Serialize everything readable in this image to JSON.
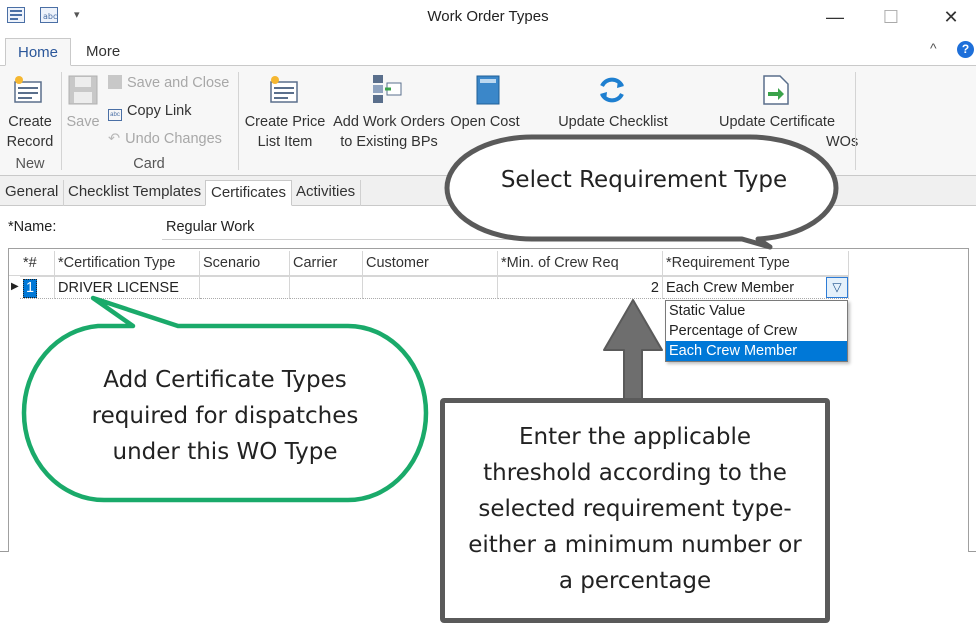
{
  "window": {
    "title": "Work Order Types",
    "minimize": "—",
    "maximize": "☐",
    "close": "✕",
    "collapse_ribbon": "^",
    "help": "?"
  },
  "ribbon_tabs": [
    "Home",
    "More"
  ],
  "ribbon": {
    "new_group": {
      "create_record": [
        "Create",
        "Record"
      ],
      "label": "New"
    },
    "card_group": {
      "save": "Save",
      "save_and_close": "Save and Close",
      "copy_link": "Copy Link",
      "undo_changes": "Undo Changes",
      "label": "Card"
    },
    "actions": {
      "create_price_list_item": [
        "Create Price",
        "List Item"
      ],
      "add_work_orders": [
        "Add Work Orders",
        "to Existing BPs"
      ],
      "open_cost": "Open Cost",
      "update_checklist": "Update Checklist",
      "update_certificate": "Update Certificate",
      "wos_fragment": "WOs"
    }
  },
  "sub_tabs": [
    "General",
    "Checklist Templates",
    "Certificates",
    "Activities"
  ],
  "form": {
    "name_label": "*Name:",
    "name_value": "Regular Work"
  },
  "grid": {
    "columns": [
      "*#",
      "*Certification Type",
      "Scenario",
      "Carrier",
      "Customer",
      "*Min. of Crew Req",
      "*Requirement Type"
    ],
    "rows": [
      {
        "num": "1",
        "certification_type": "DRIVER LICENSE",
        "scenario": "",
        "carrier": "",
        "customer": "",
        "min_crew": "2",
        "requirement_type": "Each Crew Member"
      }
    ]
  },
  "dropdown": {
    "options": [
      "Static Value",
      "Percentage of Crew",
      "Each Crew Member"
    ],
    "selected": "Each Crew Member"
  },
  "callouts": {
    "requirement": "Select Requirement Type",
    "certificate": [
      "Add Certificate Types",
      "required for dispatches",
      "under this WO Type"
    ],
    "threshold": [
      "Enter the applicable",
      "threshold according to the",
      "selected requirement type-",
      "either a minimum number or",
      "a percentage"
    ]
  },
  "colors": {
    "accent": "#2b579a",
    "selection": "#0078d7",
    "green_callout": "#1aaa6a",
    "gray_callout": "#5a5a5a"
  }
}
